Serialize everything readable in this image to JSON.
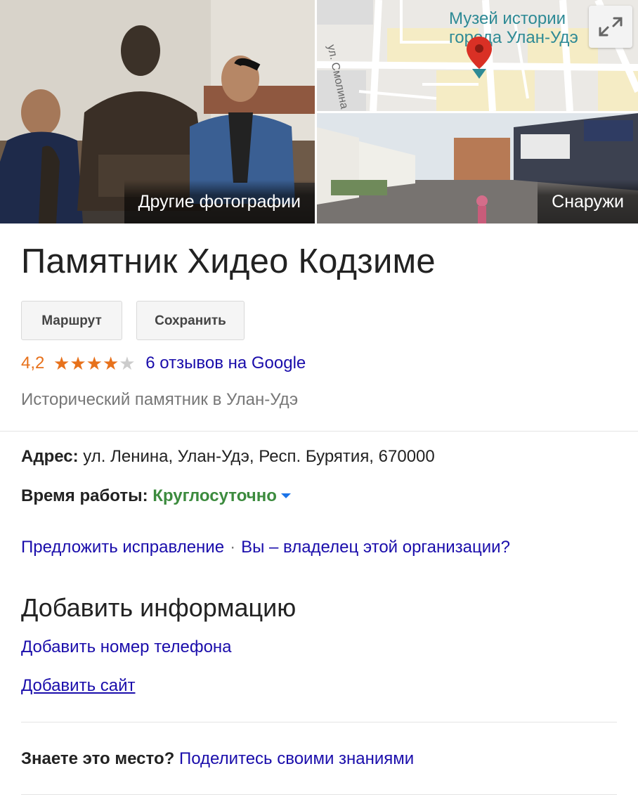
{
  "media": {
    "photos_label": "Другие фотографии",
    "street_label": "Снаружи",
    "map": {
      "place_name": "Музей истории\nгорода Улан-Удэ",
      "street_name": "ул. Смолина"
    }
  },
  "place": {
    "title": "Памятник Хидео Кодзиме",
    "buttons": {
      "route": "Маршрут",
      "save": "Сохранить"
    },
    "rating": {
      "value_text": "4,2",
      "value": 4.2,
      "max": 5,
      "reviews_link": "6 отзывов на Google"
    },
    "category": "Исторический памятник в Улан-Удэ",
    "address": {
      "label": "Адрес:",
      "value": "ул. Ленина, Улан-Удэ, Респ. Бурятия, 670000"
    },
    "hours": {
      "label": "Время работы:",
      "value": "Круглосуточно"
    },
    "suggest_edit": "Предложить исправление",
    "owner_link": "Вы – владелец этой организации?",
    "separator": "·"
  },
  "add_info": {
    "title": "Добавить информацию",
    "phone_link": "Добавить номер телефона",
    "site_link": "Добавить сайт"
  },
  "know": {
    "question": "Знаете это место?",
    "link": "Поделитесь своими знаниями"
  },
  "colors": {
    "rating": "#e7711b",
    "link": "#1a0dab",
    "open": "#3c8b3e",
    "map_label": "#2e8a95",
    "pin": "#d93025"
  }
}
